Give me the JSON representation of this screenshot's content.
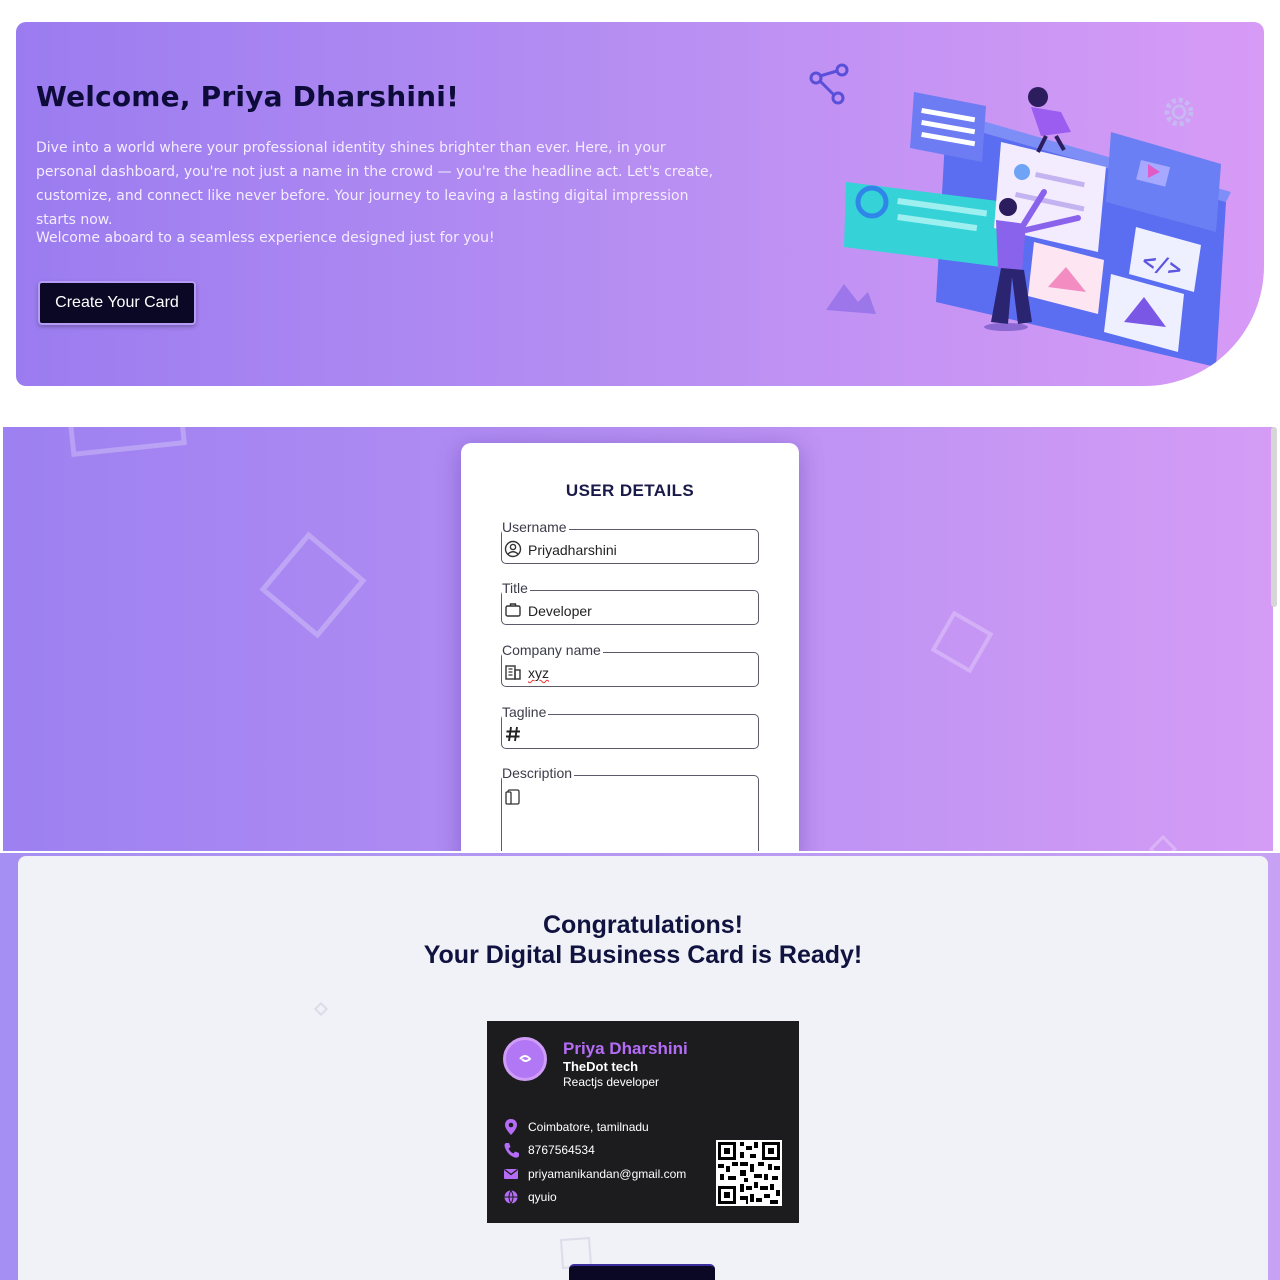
{
  "hero": {
    "title": "Welcome, Priya Dharshini!",
    "intro": "Dive into a world where your professional identity shines brighter than ever. Here, in your personal dashboard, you're not just a name in the crowd — you're the headline act. Let's create, customize, and connect like never before. Your journey to leaving a lasting digital impression starts now.",
    "welcome_line": "Welcome aboard to a seamless experience designed just for you!",
    "cta_label": "Create Your Card"
  },
  "form": {
    "title": "USER DETAILS",
    "fields": [
      {
        "label": "Username",
        "value": "Priyadharshini",
        "icon": "user-circle-icon"
      },
      {
        "label": "Title",
        "value": "Developer",
        "icon": "briefcase-icon"
      },
      {
        "label": "Company name",
        "value": "xyz",
        "icon": "building-icon"
      },
      {
        "label": "Tagline",
        "value": "",
        "icon": "hash-icon"
      },
      {
        "label": "Description",
        "value": "",
        "icon": "document-icon"
      }
    ]
  },
  "congrats": {
    "line1": "Congratulations!",
    "line2": "Your Digital Business Card is Ready!",
    "card": {
      "name": "Priya Dharshini",
      "company": "TheDot tech",
      "role": "Reactjs developer",
      "location": "Coimbatore, tamilnadu",
      "phone": "8767564534",
      "email": "priyamanikandan@gmail.com",
      "website": "qyuio",
      "accent": "#b56cf7"
    }
  },
  "colors": {
    "primary_dark": "#0b0825",
    "gradient_start": "#9b7cf0",
    "gradient_end": "#d79bf6"
  }
}
